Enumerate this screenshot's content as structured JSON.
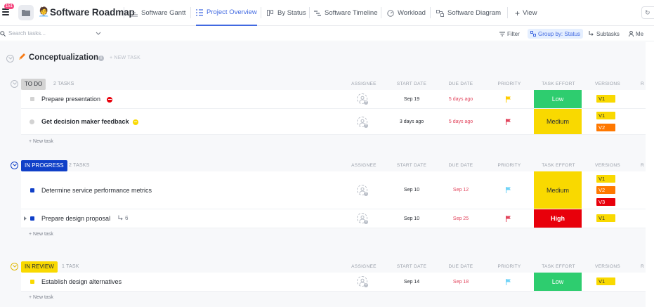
{
  "app": {
    "notification_badge": "151",
    "title": "Software Roadmap"
  },
  "views": [
    {
      "label": "Software Gantt",
      "icon": "gantt-icon"
    },
    {
      "label": "Project Overview",
      "icon": "list-icon",
      "active": true
    },
    {
      "label": "By Status",
      "icon": "board-icon"
    },
    {
      "label": "Software Timeline",
      "icon": "timeline-icon"
    },
    {
      "label": "Workload",
      "icon": "workload-icon"
    },
    {
      "label": "Software Diagram",
      "icon": "diagram-icon"
    },
    {
      "label": "View",
      "icon": "plus-icon"
    }
  ],
  "toolbar": {
    "search_placeholder": "Search tasks...",
    "filter_label": "Filter",
    "group_label": "Group by: Status",
    "subtasks_label": "Subtasks",
    "me_label": "Me"
  },
  "section": {
    "title": "Conceptualization",
    "new_task_label": "+ NEW TASK",
    "icon": "pencil-icon"
  },
  "columns": {
    "assignee": "ASSIGNEE",
    "start": "START DATE",
    "due": "DUE DATE",
    "priority": "PRIORITY",
    "effort": "TASK EFFORT",
    "versions": "VERSIONS",
    "extra": "R"
  },
  "groups": [
    {
      "status": "TO DO",
      "count": "2 TASKS",
      "pill_bg": "#d3d3d3",
      "pill_color": "#292d34",
      "add_label": "+ New task",
      "tasks": [
        {
          "name": "Prepare presentation",
          "bold": false,
          "bullet": "#d3d3d3",
          "status_icon": "blocked-icon",
          "start": "Sep 19",
          "due": "5 days ago",
          "due_red": true,
          "flag_color": "#ffcc00",
          "effort": "Low",
          "effort_bg": "#2ecd6f",
          "effort_fg": "#ffffff",
          "versions": [
            {
              "label": "V1",
              "bg": "#f9d900",
              "fg": "#292d34"
            }
          ]
        },
        {
          "name": "Get decision maker feedback",
          "bold": true,
          "bullet": "#d3d3d3",
          "status_icon": "pending-icon",
          "start": "3 days ago",
          "due": "5 days ago",
          "due_red": true,
          "flag_color": "#e2445c",
          "effort": "Medium",
          "effort_bg": "#f9d900",
          "effort_fg": "#292d34",
          "versions": [
            {
              "label": "V1",
              "bg": "#f9d900",
              "fg": "#292d34"
            },
            {
              "label": "V2",
              "bg": "#ff7800",
              "fg": "#ffffff"
            }
          ]
        }
      ]
    },
    {
      "status": "IN PROGRESS",
      "count": "2 TASKS",
      "pill_bg": "#1040c8",
      "pill_color": "#ffffff",
      "add_label": "+ New task",
      "tasks": [
        {
          "name": "Determine service performance metrics",
          "bold": false,
          "bullet": "#1040c8",
          "start": "Sep 10",
          "due": "Sep 12",
          "due_red": true,
          "flag_color": "#6fd3f7",
          "effort": "Medium",
          "effort_bg": "#f9d900",
          "effort_fg": "#292d34",
          "versions": [
            {
              "label": "V1",
              "bg": "#f9d900",
              "fg": "#292d34"
            },
            {
              "label": "V2",
              "bg": "#ff7800",
              "fg": "#ffffff"
            },
            {
              "label": "V3",
              "bg": "#e8000b",
              "fg": "#ffffff"
            }
          ]
        },
        {
          "name": "Prepare design proposal",
          "bold": false,
          "bullet": "#1040c8",
          "subtasks": "6",
          "start": "Sep 10",
          "due": "Sep 25",
          "due_red": true,
          "flag_color": "#e2445c",
          "effort": "High",
          "effort_bg": "#e8000b",
          "effort_fg": "#ffffff",
          "versions": [
            {
              "label": "V1",
              "bg": "#f9d900",
              "fg": "#292d34"
            }
          ]
        }
      ]
    },
    {
      "status": "IN REVIEW",
      "count": "1 TASK",
      "pill_bg": "#f9d900",
      "pill_color": "#292d34",
      "add_label": "+ New task",
      "tasks": [
        {
          "name": "Establish design alternatives",
          "bold": false,
          "bullet": "#f9d900",
          "start": "Sep 14",
          "due": "Sep 18",
          "due_red": true,
          "flag_color": "#6fd3f7",
          "effort": "Low",
          "effort_bg": "#2ecd6f",
          "effort_fg": "#ffffff",
          "versions": [
            {
              "label": "V1",
              "bg": "#f9d900",
              "fg": "#292d34"
            }
          ]
        }
      ]
    }
  ]
}
